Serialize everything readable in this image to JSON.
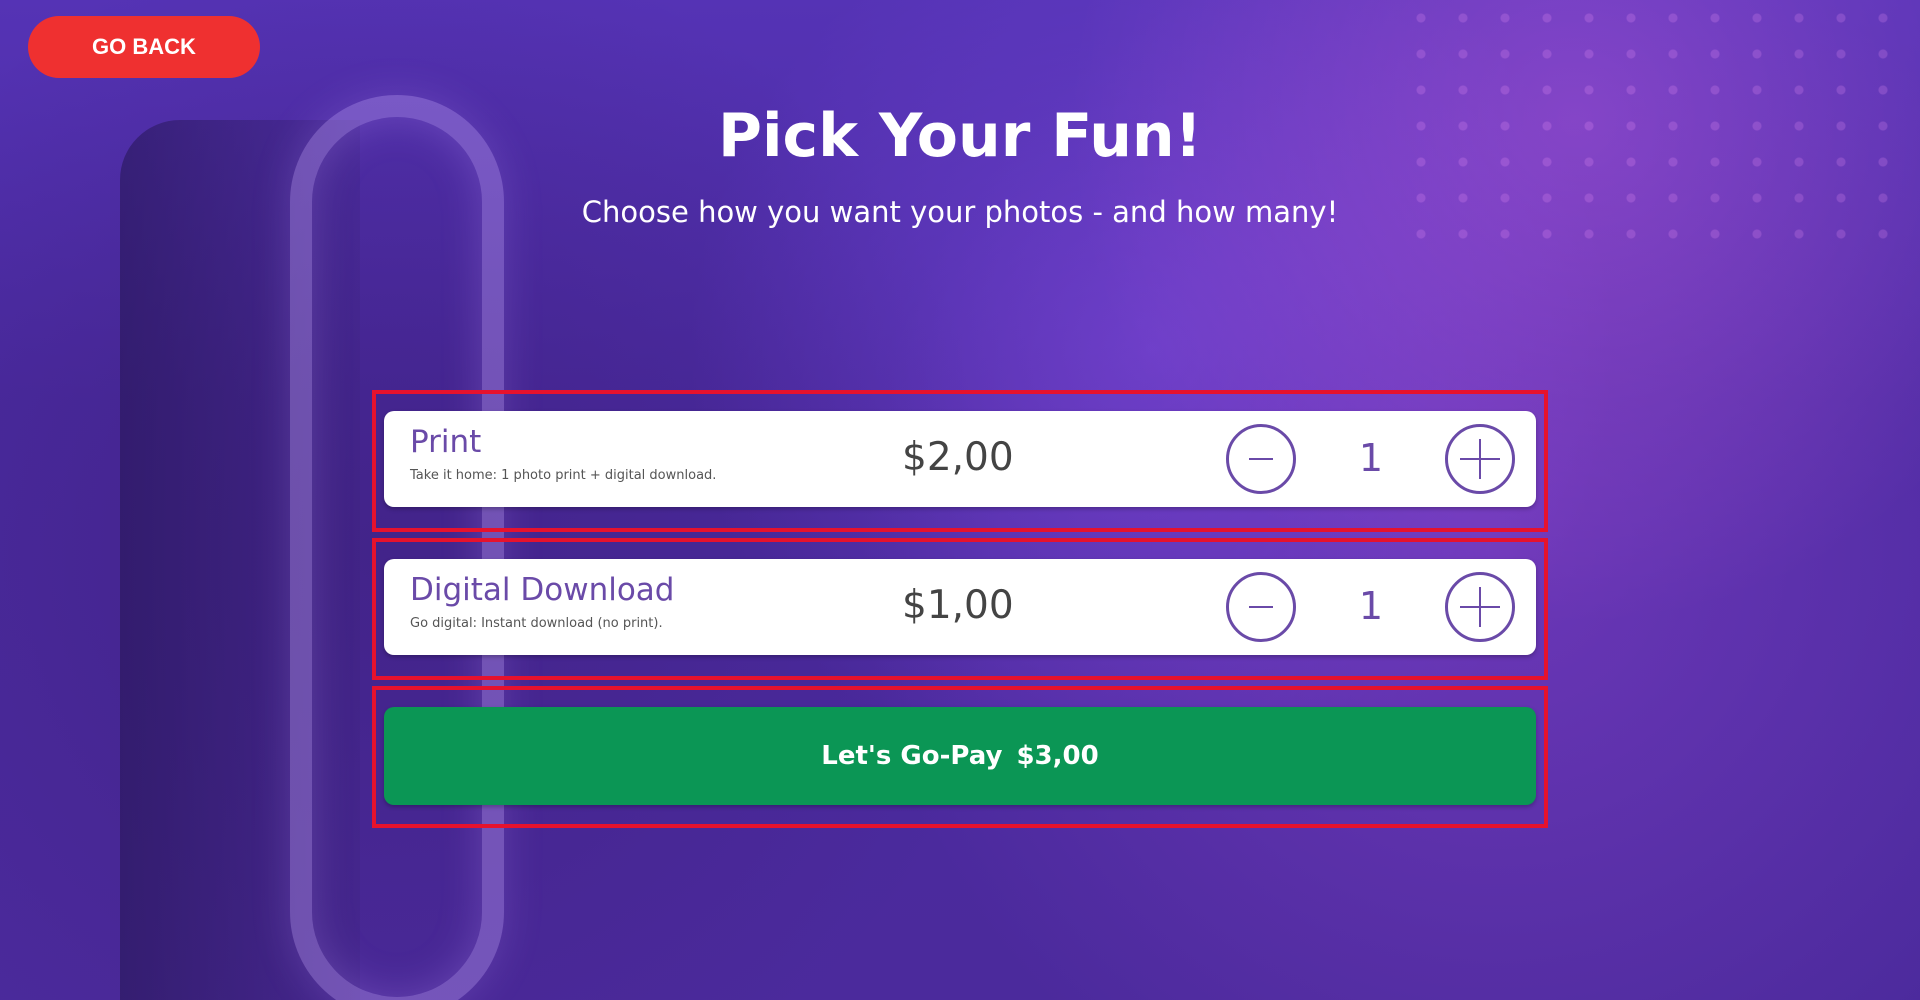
{
  "header": {
    "back_label": "GO BACK",
    "title": "Pick Your Fun!",
    "subtitle": "Choose how you want your photos - and how many!"
  },
  "options": [
    {
      "name": "Print",
      "description": "Take it home: 1 photo print + digital download.",
      "price": "$2,00",
      "quantity": "1"
    },
    {
      "name": "Digital Download",
      "description": "Go digital: Instant download (no print).",
      "price": "$1,00",
      "quantity": "1"
    }
  ],
  "pay": {
    "label": "Let's Go-Pay",
    "total": "$3,00"
  },
  "colors": {
    "back_button": "#ef3030",
    "accent": "#6a4aa8",
    "pay_button": "#0b9655",
    "highlight_frame": "#e6122d",
    "overlay": "#4a2a9a"
  },
  "icons": [
    "minus-icon",
    "plus-icon"
  ]
}
